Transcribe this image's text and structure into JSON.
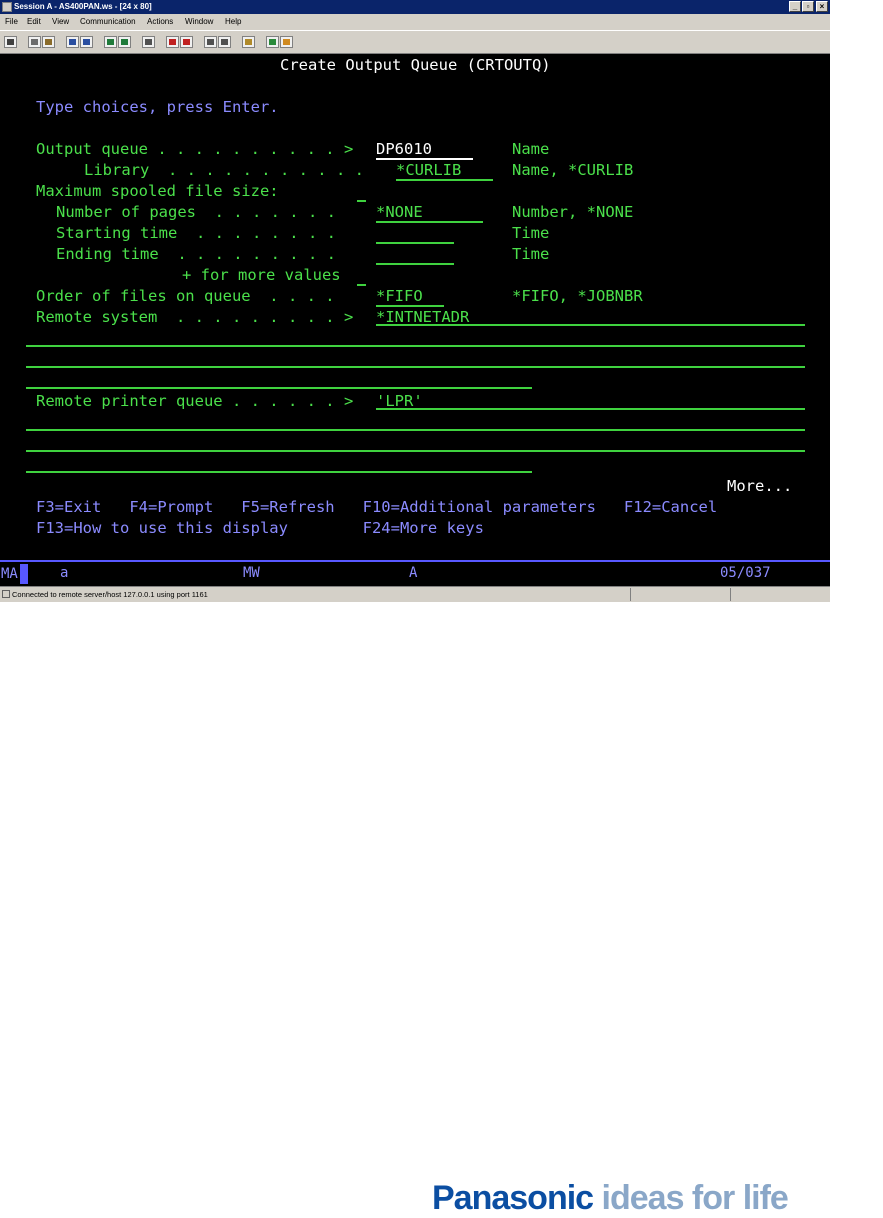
{
  "window": {
    "title": "Session A - AS400PAN.ws - [24 x 80]",
    "controls": [
      "_",
      "▫",
      "×"
    ],
    "menu": [
      "File",
      "Edit",
      "View",
      "Communication",
      "Actions",
      "Window",
      "Help"
    ]
  },
  "terminal": {
    "heading": "Create Output Queue (CRTOUTQ)",
    "instruction": "Type choices, press Enter.",
    "fields": {
      "outq_label": "Output queue . . . . . . . . . . >",
      "outq_value": "DP6010",
      "outq_hint": "Name",
      "lib_label": "Library  . . . . . . . . . . .",
      "lib_value": "*CURLIB",
      "lib_hint": "Name, *CURLIB",
      "maxsize_label": "Maximum spooled file size:",
      "pages_label": "Number of pages  . . . . . . .",
      "pages_value": "*NONE",
      "pages_hint": "Number, *NONE",
      "start_label": "Starting time  . . . . . . . .",
      "start_hint": "Time",
      "end_label": "Ending time  . . . . . . . . .",
      "end_hint": "Time",
      "more_values": "+ for more values",
      "order_label": "Order of files on queue  . . . .",
      "order_value": "*FIFO",
      "order_hint": "*FIFO, *JOBNBR",
      "rmtsys_label": "Remote system  . . . . . . . . . >",
      "rmtsys_value": "*INTNETADR",
      "rmtprtq_label": "Remote printer queue . . . . . . >",
      "rmtprtq_value": "'LPR'"
    },
    "more": "More...",
    "fkeys_line1": "F3=Exit   F4=Prompt   F5=Refresh   F10=Additional parameters   F12=Cancel",
    "fkeys_line2": "F13=How to use this display        F24=More keys"
  },
  "oia": {
    "ma": "MA",
    "a": "a",
    "mw": "MW",
    "A": "A",
    "cursor_pos": "05/037"
  },
  "statusbar": {
    "connection": "Connected to remote server/host 127.0.0.1 using port 1161"
  },
  "branding": {
    "logo": "Panasonic",
    "tagline": "ideas for life"
  }
}
